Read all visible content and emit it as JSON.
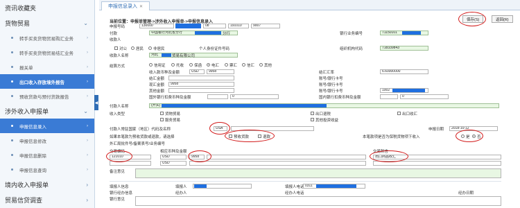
{
  "sidebar": {
    "sections": [
      {
        "label": "资讯收藏夹"
      },
      {
        "label": "货物贸易"
      },
      {
        "label": "涉外收入申报单"
      },
      {
        "label": "境内收入申报单"
      },
      {
        "label": "贸易信贷调查"
      }
    ],
    "goods_items": [
      "转手买卖货物贸易购汇业务",
      "转手买卖货物贸易结汇业务",
      "报关单",
      "出口收入存放境外报告",
      "预收货款与预付货款报告"
    ],
    "foreign_items": [
      "申报信息录入",
      "申报信息修改",
      "申报信息删除",
      "申报信息查询"
    ]
  },
  "tab": {
    "label": "申报信息录入"
  },
  "content": {
    "breadcrumb": "当前位置：申报单管理->涉外收入申报单->申报信息录入",
    "buttons": {
      "save": "保存(S)",
      "back": "返回(R)"
    },
    "fields": {
      "declare_no_label": "申报号码",
      "declare_no": [
        "130000",
        "08",
        "191010",
        "9007"
      ],
      "payer_label": "付款",
      "payer_value": "中国银行河北省分行",
      "payer_suffix": "分行",
      "payer_account_label": "银行业务编号",
      "payer_account": "71150101",
      "receiver_label": "收款人",
      "type_company": "对公",
      "type_resident": "居民",
      "type_nonresident": "非居民",
      "id_label": "个人身份证件号码",
      "org_code_label": "组织机构代码",
      "org_code": "718339843",
      "receiver_name_label": "收款人名称",
      "receiver_name": "河北",
      "receiver_name_tail": "贸易有限公司",
      "settle_label": "结算方式",
      "settle_opts": [
        "信用证",
        "托收",
        "保函",
        "电汇",
        "票汇",
        "信汇",
        "其他"
      ],
      "currency_label": "收入款币种及金额",
      "currency_code": "USD",
      "currency_amount": "9958",
      "settle_amount_label": "结汇金额",
      "exchange_label": "结汇汇率",
      "exchange_rate": "6.60000000",
      "spot_amount_label": "现汇金额",
      "spot_amount": "9958",
      "account_label": "账号/银行卡号",
      "other_amount_label": "其他金额",
      "other_amount": "1002",
      "foreign_fee_label": "国外银行扣费币种及金额",
      "foreign_fee_value": "0",
      "domestic_fee_label": "国内银行扣费币种及金额",
      "domestic_fee_value": "0",
      "payer_name_label": "付款人名称",
      "payer_name_prefix": "(开头)",
      "nature_label": "收入类型",
      "nature_opts": [
        "货物贸易",
        "服务贸易",
        "出口退税",
        "出口收汇",
        "其他投资收益"
      ],
      "country_label": "付款人常驻国家（地区）代码及名称",
      "country_code": "USA",
      "declare_date_label": "申报日期",
      "declare_date": "2018-10-12",
      "prepay_label": "如果本笔款为预收货款或退款，请选择",
      "prepay_opt": "预收货款",
      "refund_opt": "退款",
      "bonded_label": "本笔款项是否为保税货物项下收入",
      "yes": "是",
      "no": "否",
      "customs_label": "外汇局批件号/备案表号/业务编号",
      "tx_code_label": "交易编码",
      "tx_code": "121010",
      "tx_currency_label": "相应币种及金额",
      "tx_currency": "USD",
      "tx_amount": "9958",
      "tx_note_label": "交易附言",
      "tx_note": "出口商品收汇",
      "tx_currency2": "USD",
      "remark_label": "备注意见",
      "filler_label": "填报人信息",
      "filler_name_label": "填报人",
      "filler_phone_label": "填报人电话",
      "filler_phone": "0311",
      "handler_label": "银行经办信息",
      "handler_name_label": "经办人",
      "handler_phone_label": "经办人电话",
      "handler_date_label": "经办日期",
      "bank_remark_label": "银行意见"
    }
  },
  "colors": {
    "accent": "#3a7bd5",
    "redaction": "#1f6fe0",
    "annotation": "#d21a1a"
  }
}
